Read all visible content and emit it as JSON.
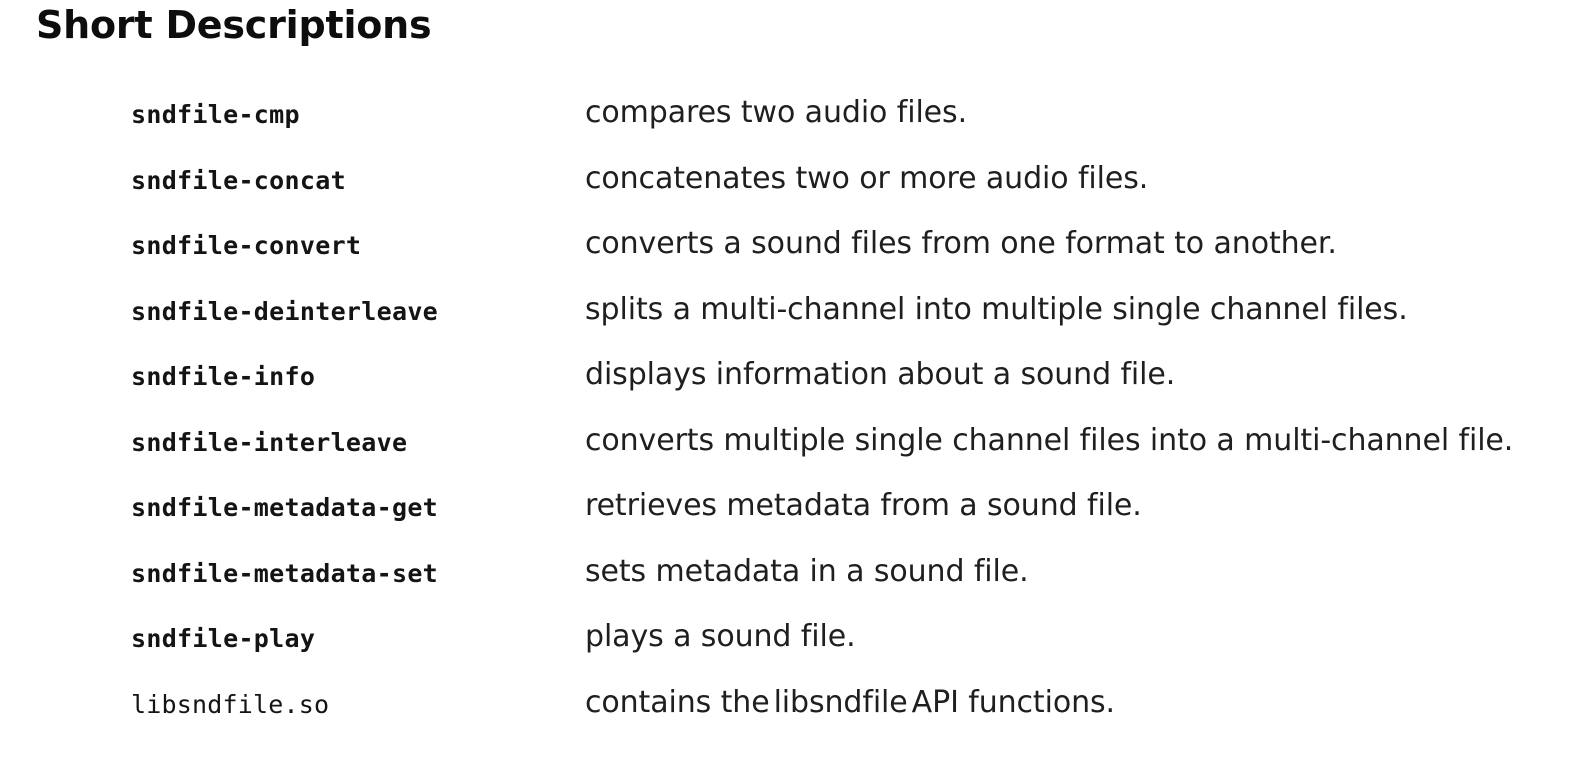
{
  "page": {
    "title": "Short Descriptions",
    "background_color": "#ffffff",
    "text_color": "#1a1a1a"
  },
  "entries": [
    {
      "term": "sndfile-cmp",
      "term_style": "bold-mono",
      "description": "compares two audio files."
    },
    {
      "term": "sndfile-concat",
      "term_style": "bold-mono",
      "description": "concatenates two or more audio files."
    },
    {
      "term": "sndfile-convert",
      "term_style": "bold-mono",
      "description": "converts a sound files from one format to another."
    },
    {
      "term": "sndfile-deinterleave",
      "term_style": "bold-mono",
      "description": "splits a multi-channel into multiple single channel files."
    },
    {
      "term": "sndfile-info",
      "term_style": "bold-mono",
      "description": "displays information about a sound file."
    },
    {
      "term": "sndfile-interleave",
      "term_style": "bold-mono",
      "description": "converts multiple single channel files into a multi-channel file."
    },
    {
      "term": "sndfile-metadata-get",
      "term_style": "bold-mono",
      "description": "retrieves metadata from a sound file."
    },
    {
      "term": "sndfile-metadata-set",
      "term_style": "bold-mono",
      "description": "sets metadata in a sound file."
    },
    {
      "term": "sndfile-play",
      "term_style": "bold-mono",
      "description": "plays a sound file."
    },
    {
      "term": "libsndfile.so",
      "term_style": "regular-mono",
      "description_parts": {
        "before": "contains the",
        "code": "libsndfile",
        "after": "API functions."
      }
    }
  ]
}
